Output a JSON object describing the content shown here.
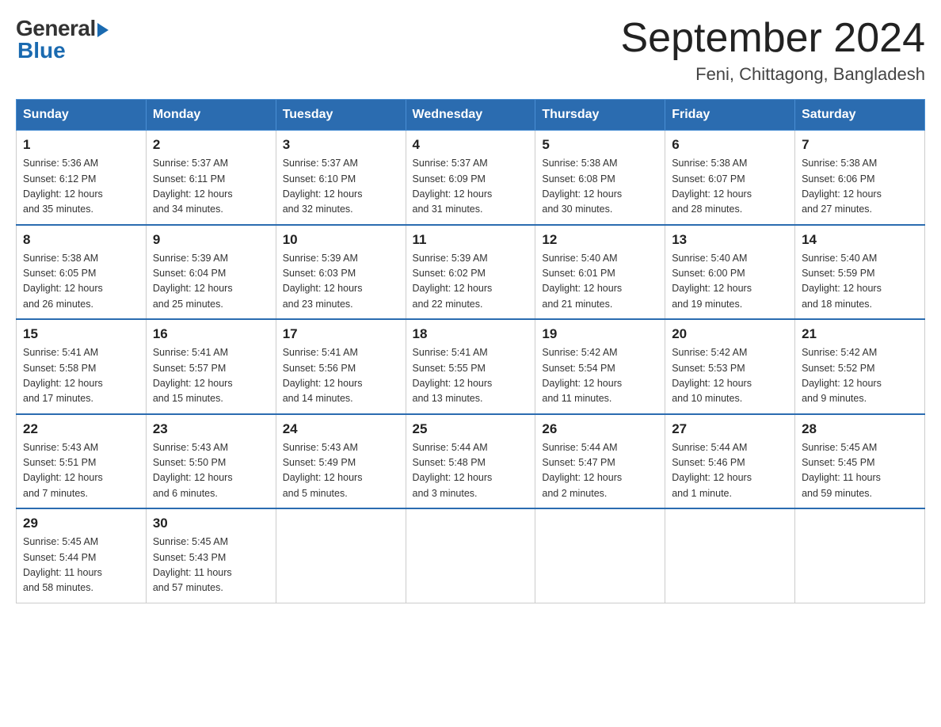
{
  "header": {
    "logo_general": "General",
    "logo_blue": "Blue",
    "title": "September 2024",
    "subtitle": "Feni, Chittagong, Bangladesh"
  },
  "weekdays": [
    "Sunday",
    "Monday",
    "Tuesday",
    "Wednesday",
    "Thursday",
    "Friday",
    "Saturday"
  ],
  "weeks": [
    [
      {
        "day": "1",
        "sunrise": "5:36 AM",
        "sunset": "6:12 PM",
        "daylight": "12 hours and 35 minutes."
      },
      {
        "day": "2",
        "sunrise": "5:37 AM",
        "sunset": "6:11 PM",
        "daylight": "12 hours and 34 minutes."
      },
      {
        "day": "3",
        "sunrise": "5:37 AM",
        "sunset": "6:10 PM",
        "daylight": "12 hours and 32 minutes."
      },
      {
        "day": "4",
        "sunrise": "5:37 AM",
        "sunset": "6:09 PM",
        "daylight": "12 hours and 31 minutes."
      },
      {
        "day": "5",
        "sunrise": "5:38 AM",
        "sunset": "6:08 PM",
        "daylight": "12 hours and 30 minutes."
      },
      {
        "day": "6",
        "sunrise": "5:38 AM",
        "sunset": "6:07 PM",
        "daylight": "12 hours and 28 minutes."
      },
      {
        "day": "7",
        "sunrise": "5:38 AM",
        "sunset": "6:06 PM",
        "daylight": "12 hours and 27 minutes."
      }
    ],
    [
      {
        "day": "8",
        "sunrise": "5:38 AM",
        "sunset": "6:05 PM",
        "daylight": "12 hours and 26 minutes."
      },
      {
        "day": "9",
        "sunrise": "5:39 AM",
        "sunset": "6:04 PM",
        "daylight": "12 hours and 25 minutes."
      },
      {
        "day": "10",
        "sunrise": "5:39 AM",
        "sunset": "6:03 PM",
        "daylight": "12 hours and 23 minutes."
      },
      {
        "day": "11",
        "sunrise": "5:39 AM",
        "sunset": "6:02 PM",
        "daylight": "12 hours and 22 minutes."
      },
      {
        "day": "12",
        "sunrise": "5:40 AM",
        "sunset": "6:01 PM",
        "daylight": "12 hours and 21 minutes."
      },
      {
        "day": "13",
        "sunrise": "5:40 AM",
        "sunset": "6:00 PM",
        "daylight": "12 hours and 19 minutes."
      },
      {
        "day": "14",
        "sunrise": "5:40 AM",
        "sunset": "5:59 PM",
        "daylight": "12 hours and 18 minutes."
      }
    ],
    [
      {
        "day": "15",
        "sunrise": "5:41 AM",
        "sunset": "5:58 PM",
        "daylight": "12 hours and 17 minutes."
      },
      {
        "day": "16",
        "sunrise": "5:41 AM",
        "sunset": "5:57 PM",
        "daylight": "12 hours and 15 minutes."
      },
      {
        "day": "17",
        "sunrise": "5:41 AM",
        "sunset": "5:56 PM",
        "daylight": "12 hours and 14 minutes."
      },
      {
        "day": "18",
        "sunrise": "5:41 AM",
        "sunset": "5:55 PM",
        "daylight": "12 hours and 13 minutes."
      },
      {
        "day": "19",
        "sunrise": "5:42 AM",
        "sunset": "5:54 PM",
        "daylight": "12 hours and 11 minutes."
      },
      {
        "day": "20",
        "sunrise": "5:42 AM",
        "sunset": "5:53 PM",
        "daylight": "12 hours and 10 minutes."
      },
      {
        "day": "21",
        "sunrise": "5:42 AM",
        "sunset": "5:52 PM",
        "daylight": "12 hours and 9 minutes."
      }
    ],
    [
      {
        "day": "22",
        "sunrise": "5:43 AM",
        "sunset": "5:51 PM",
        "daylight": "12 hours and 7 minutes."
      },
      {
        "day": "23",
        "sunrise": "5:43 AM",
        "sunset": "5:50 PM",
        "daylight": "12 hours and 6 minutes."
      },
      {
        "day": "24",
        "sunrise": "5:43 AM",
        "sunset": "5:49 PM",
        "daylight": "12 hours and 5 minutes."
      },
      {
        "day": "25",
        "sunrise": "5:44 AM",
        "sunset": "5:48 PM",
        "daylight": "12 hours and 3 minutes."
      },
      {
        "day": "26",
        "sunrise": "5:44 AM",
        "sunset": "5:47 PM",
        "daylight": "12 hours and 2 minutes."
      },
      {
        "day": "27",
        "sunrise": "5:44 AM",
        "sunset": "5:46 PM",
        "daylight": "12 hours and 1 minute."
      },
      {
        "day": "28",
        "sunrise": "5:45 AM",
        "sunset": "5:45 PM",
        "daylight": "11 hours and 59 minutes."
      }
    ],
    [
      {
        "day": "29",
        "sunrise": "5:45 AM",
        "sunset": "5:44 PM",
        "daylight": "11 hours and 58 minutes."
      },
      {
        "day": "30",
        "sunrise": "5:45 AM",
        "sunset": "5:43 PM",
        "daylight": "11 hours and 57 minutes."
      },
      null,
      null,
      null,
      null,
      null
    ]
  ],
  "labels": {
    "sunrise": "Sunrise:",
    "sunset": "Sunset:",
    "daylight": "Daylight:"
  }
}
